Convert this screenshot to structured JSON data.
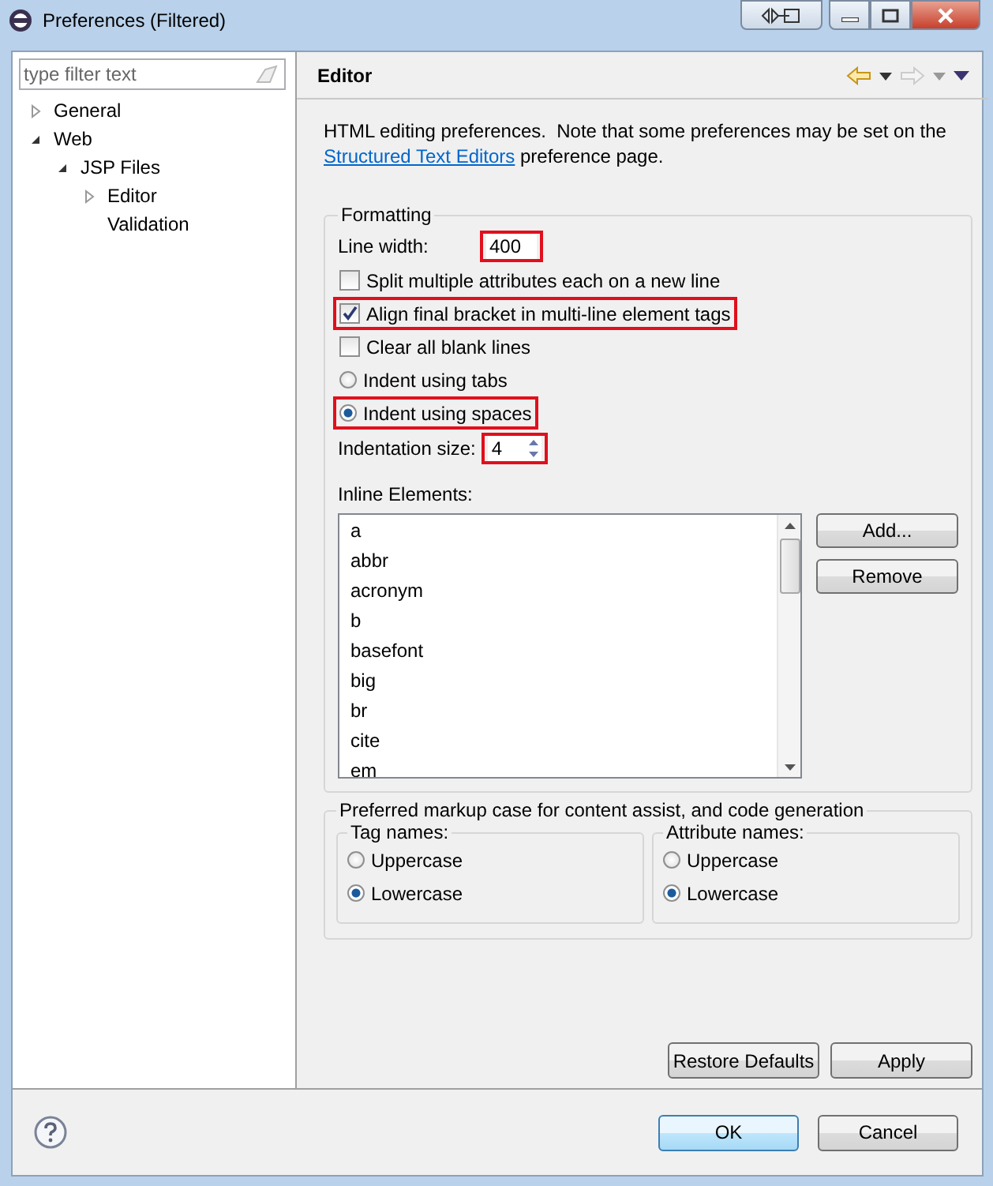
{
  "window": {
    "title": "Preferences (Filtered)"
  },
  "filter": {
    "placeholder": "type filter text"
  },
  "tree": [
    {
      "label": "General",
      "expanded": false
    },
    {
      "label": "Web",
      "expanded": true,
      "children": [
        {
          "label": "JSP Files",
          "expanded": true,
          "children": [
            {
              "label": "Editor",
              "expanded": false
            },
            {
              "label": "Validation"
            }
          ]
        }
      ]
    }
  ],
  "page": {
    "title": "Editor",
    "description": "HTML editing preferences.  Note that some preferences may be set on the ",
    "link": "Structured Text Editors",
    "description_end": " preference page."
  },
  "formatting": {
    "title": "Formatting",
    "line_width": {
      "label": "Line width:",
      "value": "400",
      "highlighted": true
    },
    "options": [
      {
        "kind": "checkbox",
        "label": "Split multiple attributes each on a new line",
        "checked": false,
        "highlighted": false
      },
      {
        "kind": "checkbox",
        "label": "Align final bracket in multi-line element tags",
        "checked": true,
        "highlighted": true
      },
      {
        "kind": "checkbox",
        "label": "Clear all blank lines",
        "checked": false,
        "highlighted": false
      },
      {
        "kind": "radio",
        "label": "Indent using tabs",
        "selected": false,
        "highlighted": false
      },
      {
        "kind": "radio",
        "label": "Indent using spaces",
        "selected": true,
        "highlighted": true
      }
    ],
    "indentation": {
      "label": "Indentation size:",
      "value": "4",
      "highlighted": true
    },
    "inline_label": "Inline Elements:",
    "inline_elements": [
      "a",
      "abbr",
      "acronym",
      "b",
      "basefont",
      "big",
      "br",
      "cite",
      "em"
    ],
    "buttons": [
      "Add...",
      "Remove"
    ]
  },
  "markup_case": {
    "title": "Preferred markup case for content assist, and code generation",
    "groups": [
      {
        "title": "Tag names:",
        "options": [
          {
            "label": "Uppercase",
            "selected": false
          },
          {
            "label": "Lowercase",
            "selected": true
          }
        ]
      },
      {
        "title": "Attribute names:",
        "options": [
          {
            "label": "Uppercase",
            "selected": false
          },
          {
            "label": "Lowercase",
            "selected": true
          }
        ]
      }
    ]
  },
  "page_buttons": [
    "Restore Defaults",
    "Apply"
  ],
  "dialog_buttons": [
    {
      "label": "OK",
      "default": true
    },
    {
      "label": "Cancel",
      "default": false
    }
  ]
}
